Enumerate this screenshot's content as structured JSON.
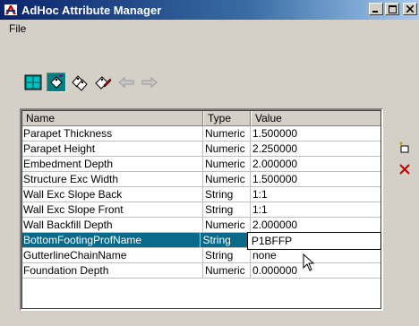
{
  "window": {
    "title": "AdHoc Attribute Manager",
    "icon": "app-logo-icon"
  },
  "menu": {
    "items": [
      "File"
    ]
  },
  "toolbar": {
    "buttons": [
      {
        "name": "grid-view-icon"
      },
      {
        "name": "attribute-tag-icon",
        "pressed": true
      },
      {
        "name": "multi-tag-icon"
      },
      {
        "name": "tag-edit-icon"
      },
      {
        "name": "arrow-left-icon"
      },
      {
        "name": "arrow-right-icon"
      }
    ]
  },
  "table": {
    "headers": {
      "name": "Name",
      "type": "Type",
      "value": "Value"
    },
    "rows": [
      {
        "name": "Parapet Thickness",
        "type": "Numeric",
        "value": "1.500000"
      },
      {
        "name": "Parapet Height",
        "type": "Numeric",
        "value": "2.250000"
      },
      {
        "name": "Embedment Depth",
        "type": "Numeric",
        "value": "2.000000"
      },
      {
        "name": "Structure Exc Width",
        "type": "Numeric",
        "value": "1.500000"
      },
      {
        "name": "Wall Exc Slope Back",
        "type": "String",
        "value": "1:1"
      },
      {
        "name": "Wall Exc Slope Front",
        "type": "String",
        "value": "1:1"
      },
      {
        "name": "Wall Backfill Depth",
        "type": "Numeric",
        "value": "2.000000"
      },
      {
        "name": "BottomFootingProfName",
        "type": "String",
        "value": "P1BFFP"
      },
      {
        "name": "GutterlineChainName",
        "type": "String",
        "value": "none"
      },
      {
        "name": "Foundation Depth",
        "type": "Numeric",
        "value": "0.000000"
      }
    ]
  },
  "side_buttons": [
    {
      "name": "add-attribute-icon"
    },
    {
      "name": "delete-icon",
      "color": "#c00000"
    }
  ],
  "colors": {
    "selection": "#0a6a8a",
    "title_start": "#0a246a"
  }
}
